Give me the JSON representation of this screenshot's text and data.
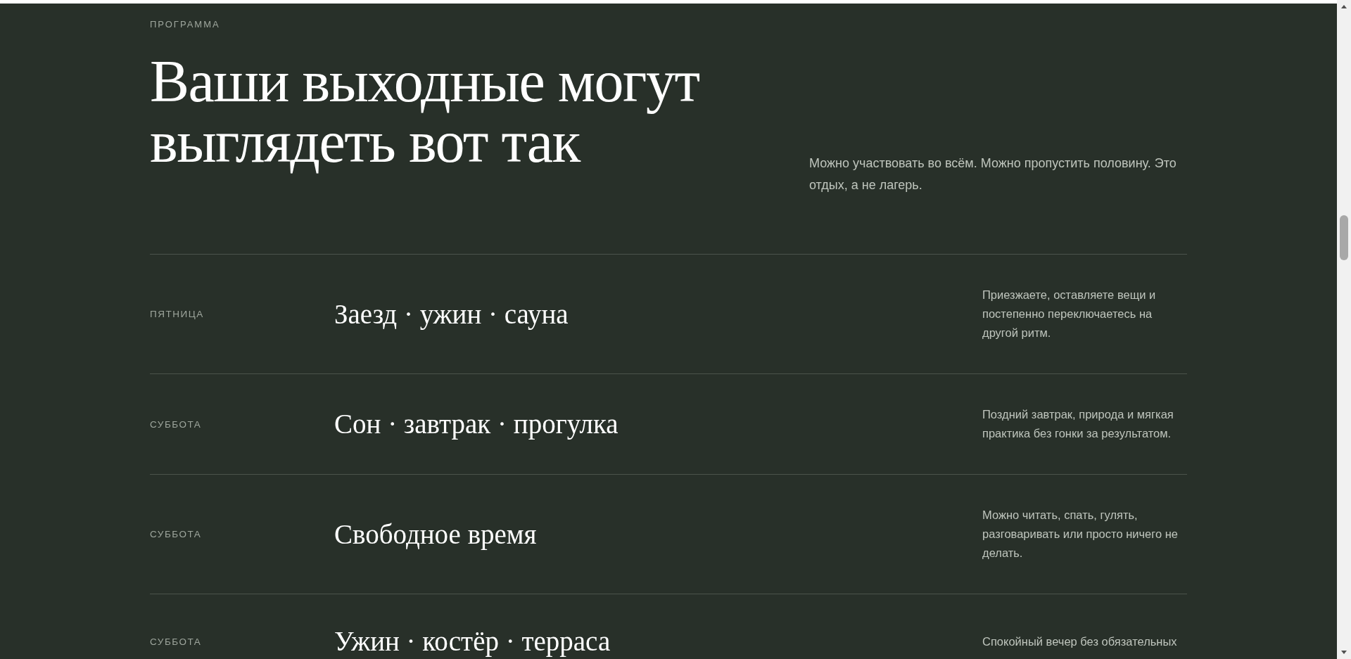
{
  "section_label": "ПРОГРАММА",
  "heading": "Ваши выходные могут выглядеть вот так",
  "intro": "Можно участвовать во всём. Можно пропустить половину. Это отдых, а не лагерь.",
  "schedule": [
    {
      "day": "ПЯТНИЦА",
      "title": "Заезд · ужин · сауна",
      "description": "Приезжаете, оставляете вещи и постепенно переключаетесь на другой ритм."
    },
    {
      "day": "СУББОТА",
      "title": "Сон · завтрак · прогулка",
      "description": "Поздний завтрак, природа и мягкая практика без гонки за результатом."
    },
    {
      "day": "СУББОТА",
      "title": "Свободное время",
      "description": "Можно читать, спать, гулять, разговаривать или просто ничего не делать."
    },
    {
      "day": "СУББОТА",
      "title": "Ужин · костёр · терраса",
      "description": "Спокойный вечер без обязательных"
    }
  ]
}
